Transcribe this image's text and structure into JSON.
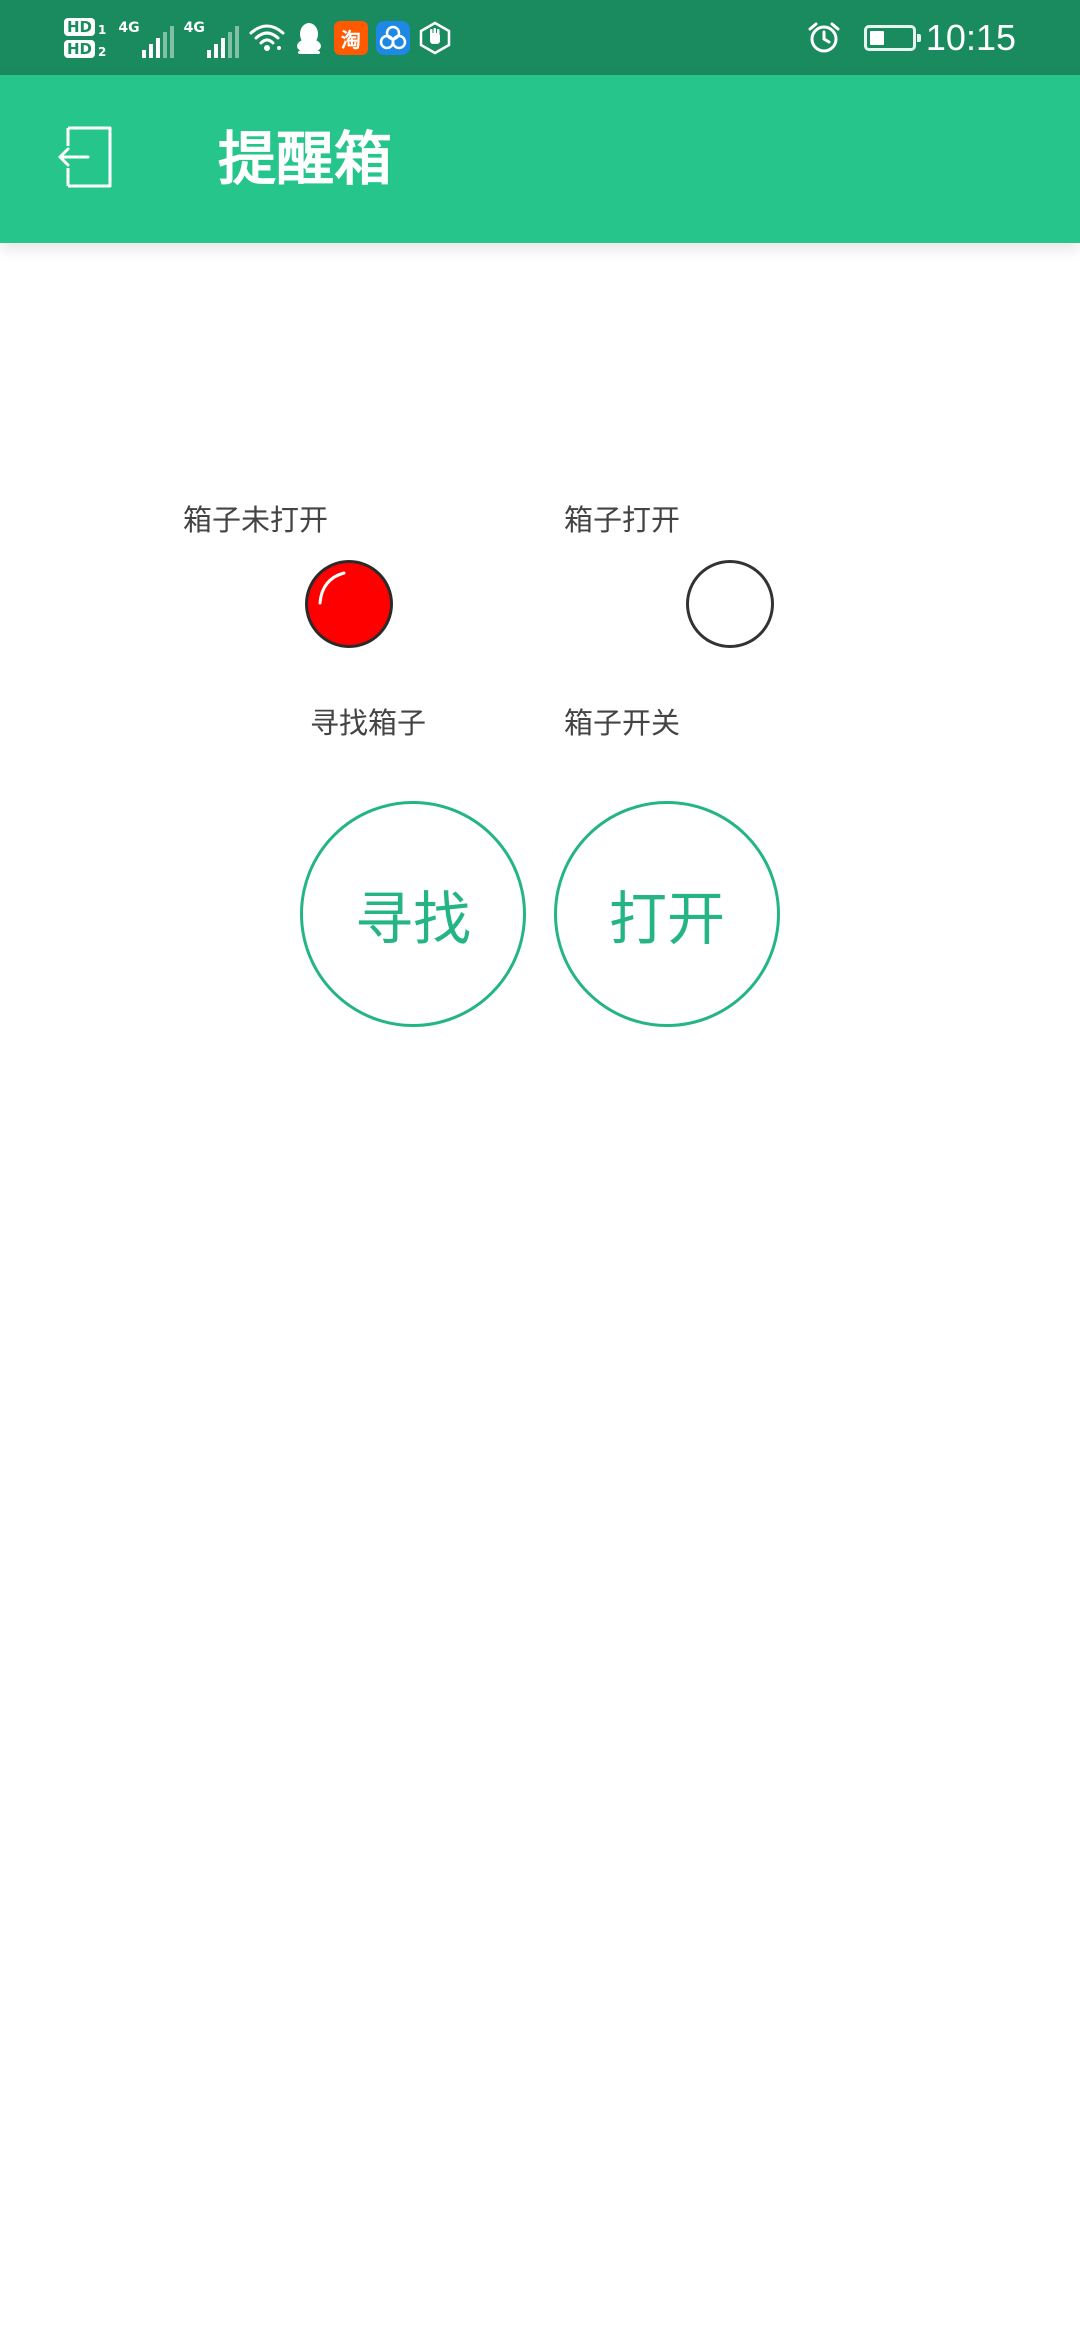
{
  "status_bar": {
    "hd1": "HD",
    "hd1_sub": "1",
    "hd2": "HD",
    "hd2_sub": "2",
    "net1": "4G",
    "net2": "4G",
    "taobao_glyph": "淘",
    "battery_level": 0.35,
    "time": "10:15",
    "icons": [
      "wifi-icon",
      "qq-penguin-icon",
      "taobao-icon",
      "triangle-app-icon",
      "hand-hexagon-icon",
      "alarm-icon",
      "battery-icon"
    ]
  },
  "app_bar": {
    "title": "提醒箱",
    "back_icon": "exit-icon"
  },
  "indicators": {
    "closed_label": "箱子未打开",
    "open_label": "箱子打开",
    "closed_color": "#ff0000",
    "open_color": "#ffffff"
  },
  "actions": {
    "find_label": "寻找箱子",
    "switch_label": "箱子开关",
    "find_button": "寻找",
    "open_button": "打开",
    "accent_color": "#25b585"
  },
  "colors": {
    "status_bar": "#1a8a5f",
    "app_bar": "#25c58b"
  }
}
